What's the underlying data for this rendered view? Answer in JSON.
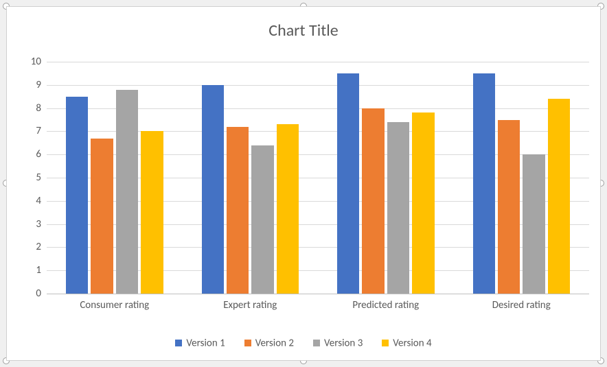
{
  "chart_data": {
    "type": "bar",
    "title": "Chart Title",
    "categories": [
      "Consumer rating",
      "Expert rating",
      "Predicted rating",
      "Desired rating"
    ],
    "series": [
      {
        "name": "Version 1",
        "color": "#4472C4",
        "values": [
          8.5,
          9.0,
          9.5,
          9.5
        ]
      },
      {
        "name": "Version 2",
        "color": "#ED7D31",
        "values": [
          6.7,
          7.2,
          8.0,
          7.5
        ]
      },
      {
        "name": "Version 3",
        "color": "#A5A5A5",
        "values": [
          8.8,
          6.4,
          7.4,
          6.0
        ]
      },
      {
        "name": "Version 4",
        "color": "#FFC000",
        "values": [
          7.0,
          7.3,
          7.8,
          8.4
        ]
      }
    ],
    "ylim": [
      0,
      10
    ],
    "yticks": [
      0,
      1,
      2,
      3,
      4,
      5,
      6,
      7,
      8,
      9,
      10
    ],
    "xlabel": "",
    "ylabel": "",
    "grid": true,
    "legend_position": "bottom"
  }
}
